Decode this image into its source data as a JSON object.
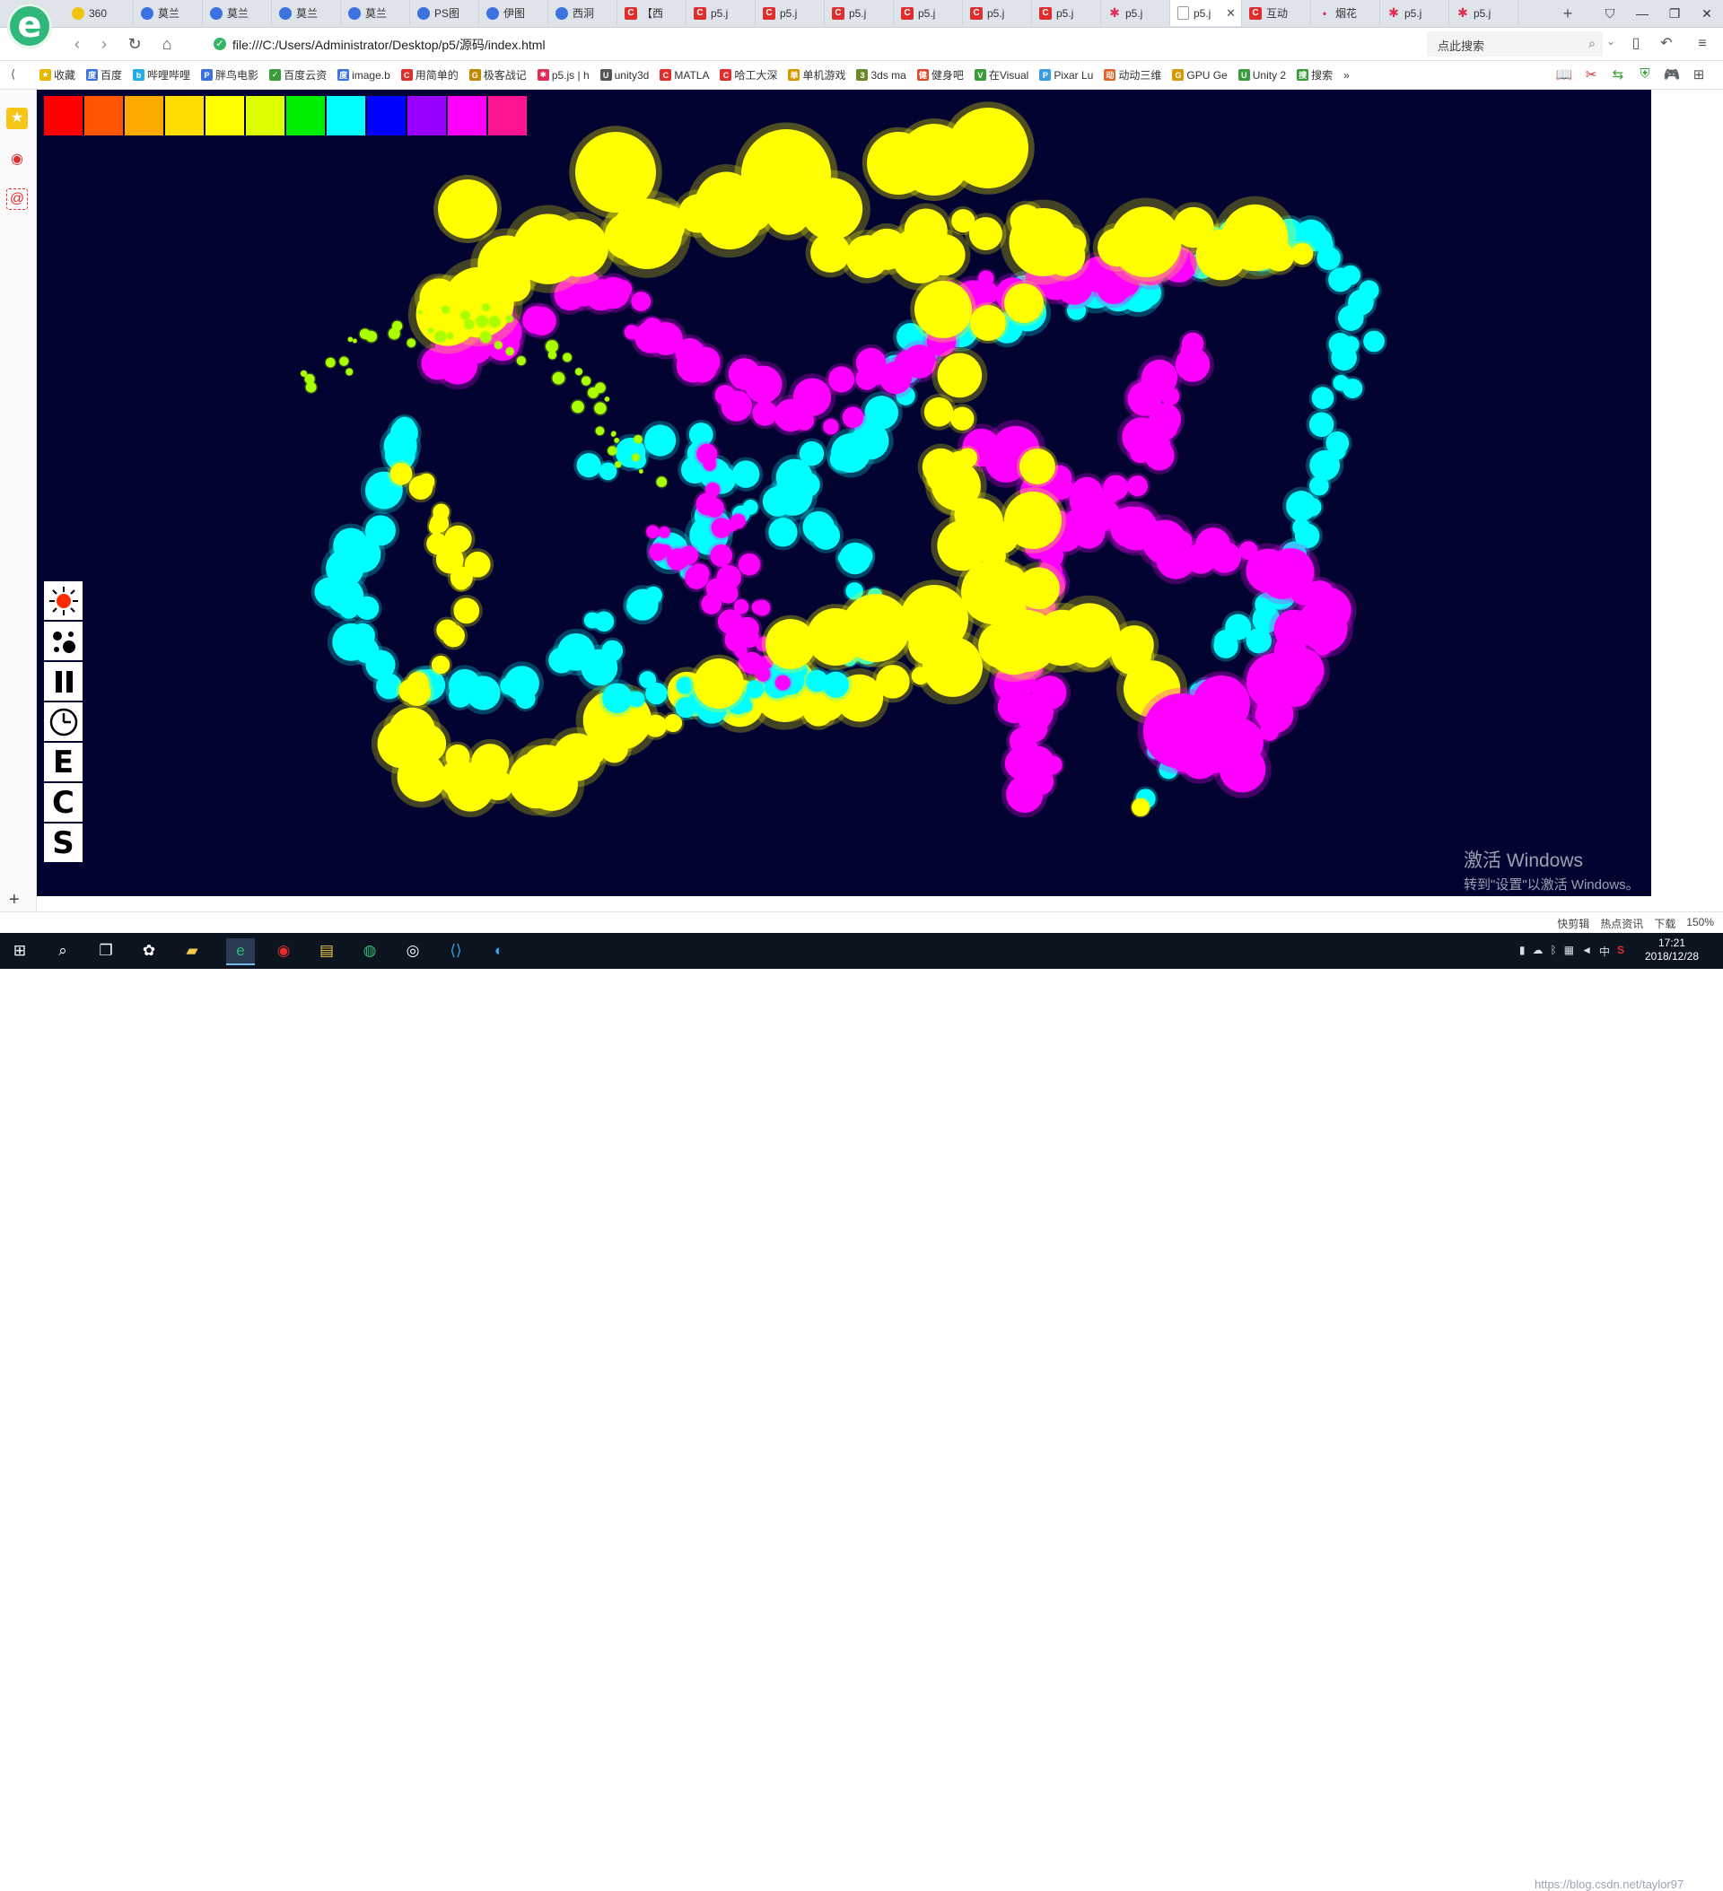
{
  "browser": {
    "logo_letter": "e",
    "tabs": [
      {
        "icon": "n360",
        "glyph": "",
        "label": "360"
      },
      {
        "icon": "paw",
        "glyph": "",
        "label": "莫兰"
      },
      {
        "icon": "paw",
        "glyph": "",
        "label": "莫兰"
      },
      {
        "icon": "paw",
        "glyph": "",
        "label": "莫兰"
      },
      {
        "icon": "paw",
        "glyph": "",
        "label": "莫兰"
      },
      {
        "icon": "ps",
        "glyph": "",
        "label": "PS图"
      },
      {
        "icon": "paw",
        "glyph": "",
        "label": "伊图"
      },
      {
        "icon": "paw",
        "glyph": "",
        "label": "西洞"
      },
      {
        "icon": "csdn",
        "glyph": "C",
        "label": "【西"
      },
      {
        "icon": "csdn",
        "glyph": "C",
        "label": "p5.j"
      },
      {
        "icon": "csdn",
        "glyph": "C",
        "label": "p5.j"
      },
      {
        "icon": "csdn",
        "glyph": "C",
        "label": "p5.j"
      },
      {
        "icon": "csdn",
        "glyph": "C",
        "label": "p5.j"
      },
      {
        "icon": "csdn",
        "glyph": "C",
        "label": "p5.j"
      },
      {
        "icon": "csdn",
        "glyph": "C",
        "label": "p5.j"
      },
      {
        "icon": "star",
        "glyph": "✱",
        "label": "p5.j"
      },
      {
        "icon": "doc",
        "glyph": "",
        "label": "p5.j",
        "active": true
      },
      {
        "icon": "csdn",
        "glyph": "C",
        "label": "互动"
      },
      {
        "icon": "dot",
        "glyph": "•",
        "label": "烟花"
      },
      {
        "icon": "star",
        "glyph": "✱",
        "label": "p5.j"
      },
      {
        "icon": "star",
        "glyph": "✱",
        "label": "p5.j"
      }
    ],
    "active_tab_close": "✕",
    "new_tab": "+",
    "window_buttons": {
      "pin": "⛉",
      "minimize": "—",
      "restore": "❐",
      "close": "✕"
    },
    "nav": {
      "back": "‹",
      "forward": "›",
      "reload": "↻",
      "home": "⌂"
    },
    "url": "file:///C:/Users/Administrator/Desktop/p5/源码/index.html",
    "search_placeholder": "点此搜索",
    "bookmarks": [
      {
        "label": "收藏",
        "color": "#e6b800",
        "glyph": "★"
      },
      {
        "label": "百度",
        "color": "#3b72e0",
        "glyph": "度"
      },
      {
        "label": "哔哩哔哩",
        "color": "#23ade5",
        "glyph": "b"
      },
      {
        "label": "胖鸟电影",
        "color": "#3b72e0",
        "glyph": "P"
      },
      {
        "label": "百度云资",
        "color": "#3a9c3a",
        "glyph": "✓"
      },
      {
        "label": "image.b",
        "color": "#3b72e0",
        "glyph": "度"
      },
      {
        "label": "用简单的",
        "color": "#e02d2d",
        "glyph": "C"
      },
      {
        "label": "极客战记",
        "color": "#c08a00",
        "glyph": "G"
      },
      {
        "label": "p5.js | h",
        "color": "#e02d55",
        "glyph": "✱"
      },
      {
        "label": "unity3d",
        "color": "#555555",
        "glyph": "U"
      },
      {
        "label": "MATLA",
        "color": "#e02d2d",
        "glyph": "C"
      },
      {
        "label": "哈工大深",
        "color": "#e02d2d",
        "glyph": "C"
      },
      {
        "label": "单机游戏",
        "color": "#d49a00",
        "glyph": "单"
      },
      {
        "label": "3ds ma",
        "color": "#6a8a2a",
        "glyph": "3"
      },
      {
        "label": "健身吧",
        "color": "#e04a2d",
        "glyph": "健"
      },
      {
        "label": "在Visual",
        "color": "#3a9c3a",
        "glyph": "V"
      },
      {
        "label": "Pixar Lu",
        "color": "#3b9ce0",
        "glyph": "P"
      },
      {
        "label": "动动三维",
        "color": "#e0662d",
        "glyph": "动"
      },
      {
        "label": "GPU Ge",
        "color": "#d49a00",
        "glyph": "G"
      },
      {
        "label": "Unity 2",
        "color": "#3a9c3a",
        "glyph": "U"
      },
      {
        "label": "搜索",
        "color": "#3a9c3a",
        "glyph": "搜"
      }
    ],
    "bookmarks_more": "»"
  },
  "sketch": {
    "background": "#030332",
    "palette": [
      "#ff0000",
      "#ff5500",
      "#ffaa00",
      "#ffdd00",
      "#ffff00",
      "#ddff00",
      "#00ee00",
      "#00ffff",
      "#0000ff",
      "#9900ff",
      "#ff00ff",
      "#ff1493"
    ],
    "tools": [
      {
        "name": "sun-tool",
        "glyph": ""
      },
      {
        "name": "dots-tool",
        "glyph": ""
      },
      {
        "name": "pause-tool",
        "glyph": "II"
      },
      {
        "name": "clock-tool",
        "glyph": ""
      },
      {
        "name": "e-tool",
        "glyph": "E"
      },
      {
        "name": "c-tool",
        "glyph": "C"
      },
      {
        "name": "s-tool",
        "glyph": "S"
      }
    ]
  },
  "watermark": {
    "title": "激活 Windows",
    "subtitle": "转到\"设置\"以激活 Windows。"
  },
  "statusbar": [
    "快剪辑",
    "热点资讯",
    "下载",
    "150%"
  ],
  "taskbar": {
    "blog_watermark": "https://blog.csdn.net/taylor97",
    "tray_input": "中",
    "tray_s": "S",
    "clock_time": "17:21",
    "clock_date": "2018/12/28"
  }
}
